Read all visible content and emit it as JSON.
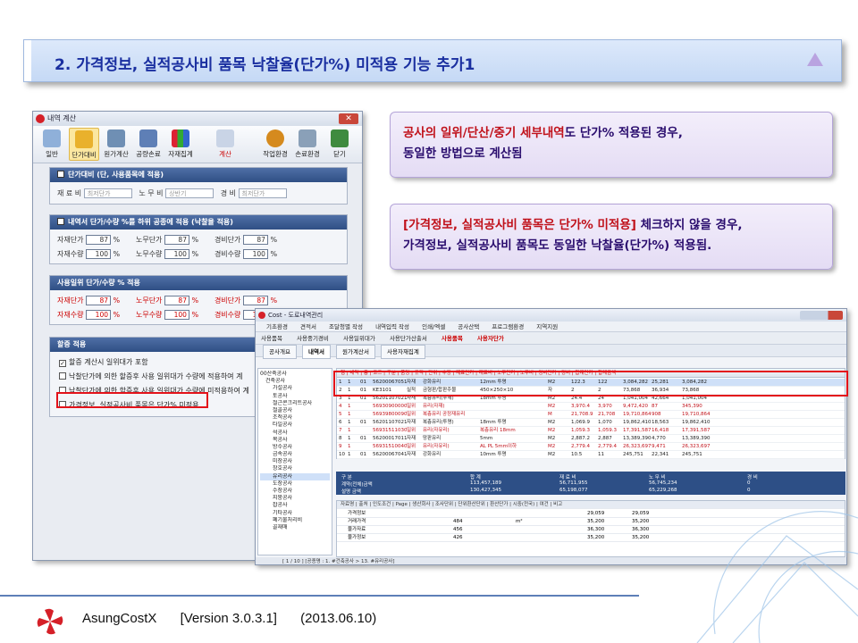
{
  "banner": {
    "title": "2. 가격정보, 실적공사비 품목 낙찰율(단가%) 미적용 기능 추가1"
  },
  "callouts": {
    "c1_line1_red": "공사의 일위/단산/중기 세부내역",
    "c1_line1_rest": "도 단가% 적용된 경우,",
    "c1_line2": "동일한 방법으로 계산됨",
    "c2_line1_red": "[가격정보, 실적공사비 품목은 단가% 미적용]",
    "c2_line1_rest": " 체크하지 않을 경우,",
    "c2_line2": "가격정보, 실적공사비 품목도 동일한 낙찰율(단가%) 적용됨."
  },
  "win1": {
    "title": "내역 계산",
    "toolbar": [
      "일반",
      "단가대비",
      "원가계산",
      "공량손료",
      "자재집계",
      "계산",
      "작업환경",
      "손료환경",
      "닫기"
    ],
    "sec1": {
      "header": "단가대비 (단, 사용품목에 적용)",
      "labels": [
        "재 료 비",
        "노 무 비",
        "경 비"
      ],
      "values": [
        "최저단가",
        "상반기",
        "최저단가"
      ]
    },
    "sec2": {
      "header": "내역서 단가/수량 %를 하위 공종에 적용 (낙찰율 적용)",
      "labels": [
        "자재단가",
        "노무단가",
        "경비단가",
        "자재수량",
        "노무수량",
        "경비수량"
      ],
      "values": [
        "87",
        "87",
        "87",
        "100",
        "100",
        "100"
      ],
      "unit": "%"
    },
    "sec3": {
      "header": "사용일위 단가/수량 % 적용",
      "labels": [
        "자재단가",
        "노무단가",
        "경비단가",
        "자재수량",
        "노무수량",
        "경비수량"
      ],
      "values": [
        "87",
        "87",
        "87",
        "100",
        "100",
        "100"
      ],
      "unit": "%"
    },
    "sec4": {
      "header": "할증 적용",
      "options": [
        "할증 계산시 일위대가 포함",
        "낙찰단가에 의한 할증후 사용 일위대가 수량에 적용하여 계",
        "낙찰단가에 의한 할증후 사용 일위대가 수량에 미적용하여 계",
        "가격정보, 실적공사비 품목은 단가% 미적용"
      ],
      "checked": [
        true,
        false,
        false,
        false
      ]
    }
  },
  "win2": {
    "title": "Cost - 도로내역관리",
    "menu": [
      "기초환경",
      "견적서",
      "조달청별 작성",
      "내역입력 작성",
      "인쇄/엑셀",
      "공사산택",
      "프로그램환경",
      "지역지원"
    ],
    "tool": [
      "사용품목",
      "사용중기경비",
      "사용일위대가",
      "사용단가산출서",
      "사용품목",
      "사용자단가"
    ],
    "tabs": [
      "공사개요",
      "내역서",
      "원가계산서",
      "사용자재집계"
    ],
    "tree": [
      "00산축공사",
      "건축공사",
      "가설공사",
      "토공사",
      "철근콘크리트공사",
      "철골공사",
      "조적공사",
      "타일공사",
      "석공사",
      "목공사",
      "방수공사",
      "금속공사",
      "미장공사",
      "창호공사",
      "유리공사",
      "도장공사",
      "수장공사",
      "지붕공사",
      "잡공사",
      "기타공사",
      "폐기물처리비",
      "골재매"
    ],
    "grid_header": "행 | 내역 | 층 | 코드 | 구분 | 품명 | 규격 | 단위 | 수량 | 재료단가 | 재료비 | 노무단가 | 노무비 | 경비단가 | 경비 | 합계단가 | 합계금액",
    "rows": [
      [
        "1",
        "1",
        "01",
        "56200067051",
        "자재",
        "강화유리",
        "12mm 투명",
        "M2",
        "122.3",
        "122",
        "3,084,282",
        "25,281",
        "3,084,282"
      ],
      [
        "2",
        "1",
        "01",
        "KE3101",
        "실적",
        "금형판/합판주물",
        "450×250×10",
        "자",
        "2",
        "2",
        "73,868",
        "36,934",
        "73,868"
      ],
      [
        "3",
        "1",
        "01",
        "56201107021",
        "자재",
        "복층유리(두께)",
        "18mm 투명",
        "M2",
        "24.4",
        "24",
        "1,041,004",
        "42,664",
        "1,041,004"
      ],
      [
        "4",
        "1",
        "",
        "56930900000",
        "일위",
        "유리(자재)",
        "",
        "M2",
        "3,970.4",
        "3,970",
        "9,472,420",
        "87",
        "345,390"
      ],
      [
        "5",
        "1",
        "",
        "56939800090",
        "일위",
        "복층유리 공정재유리",
        "",
        "M",
        "21,708.9",
        "21,708",
        "19,710,864",
        "908",
        "19,710,864"
      ],
      [
        "6",
        "1",
        "01",
        "56201107021",
        "자재",
        "복층유리(투명)",
        "18mm 투명",
        "M2",
        "1,069.9",
        "1,070",
        "19,862,410",
        "18,563",
        "19,862,410"
      ],
      [
        "7",
        "1",
        "",
        "56931511030",
        "일위",
        "유리(자유리)",
        "복층유리 18mm",
        "M2",
        "1,059.3",
        "1,059.3",
        "17,391,587",
        "16,418",
        "17,391,587"
      ],
      [
        "8",
        "1",
        "01",
        "56200017011",
        "자재",
        "망판유리",
        "5mm",
        "M2",
        "2,887.2",
        "2,887",
        "13,389,390",
        "4,770",
        "13,389,390"
      ],
      [
        "9",
        "1",
        "",
        "56931510040",
        "일위",
        "유리(자유리)",
        "AL PL 5mm이하",
        "M2",
        "2,779.4",
        "2,779.4",
        "26,323,697",
        "9,471",
        "26,323,697"
      ],
      [
        "10",
        "1",
        "01",
        "56200067041",
        "자재",
        "강화유리",
        "10mm 투명",
        "M2",
        "10.5",
        "11",
        "245,751",
        "22,341",
        "245,751"
      ]
    ],
    "totals": {
      "headers": [
        "구 분",
        "합 계",
        "재 료 비",
        "노 무 비",
        "경 비"
      ],
      "row1": [
        "계약(전체)금액",
        "113,457,189",
        "56,711,955",
        "56,745,234",
        "0"
      ],
      "row2": [
        "설명 금액",
        "130,427,345",
        "65,198,077",
        "65,229,268",
        "0"
      ]
    },
    "sub_header": "자료명 | 출처 | 인도조건 | Page | 생산회사 | 조사단위 | 단위환산단위 | 환산단가 | 시중(전국) | 여건 | 비고",
    "sub_rows": [
      [
        "가격정보",
        "",
        "",
        "",
        "",
        "",
        "",
        "29,059",
        "29,059"
      ],
      [
        "거래가격",
        "",
        "",
        "484",
        "",
        "m²",
        "",
        "35,200",
        "35,200"
      ],
      [
        "물가자료",
        "",
        "",
        "456",
        "",
        "",
        "",
        "36,300",
        "36,300"
      ],
      [
        "물가정보",
        "",
        "",
        "426",
        "",
        "",
        "",
        "35,200",
        "35,200"
      ]
    ],
    "status": "[ 1 / 10 ]     [공종명 : 1. #건축공사 > 13. #유리공사]"
  },
  "footer": {
    "product": "AsungCostX",
    "version": "[Version 3.0.3.1]",
    "date": "(2013.06.10)"
  },
  "colors": {
    "banner_title": "#1a2fa0",
    "highlight": "#e3121a",
    "callout_text": "#2a0d6e"
  }
}
